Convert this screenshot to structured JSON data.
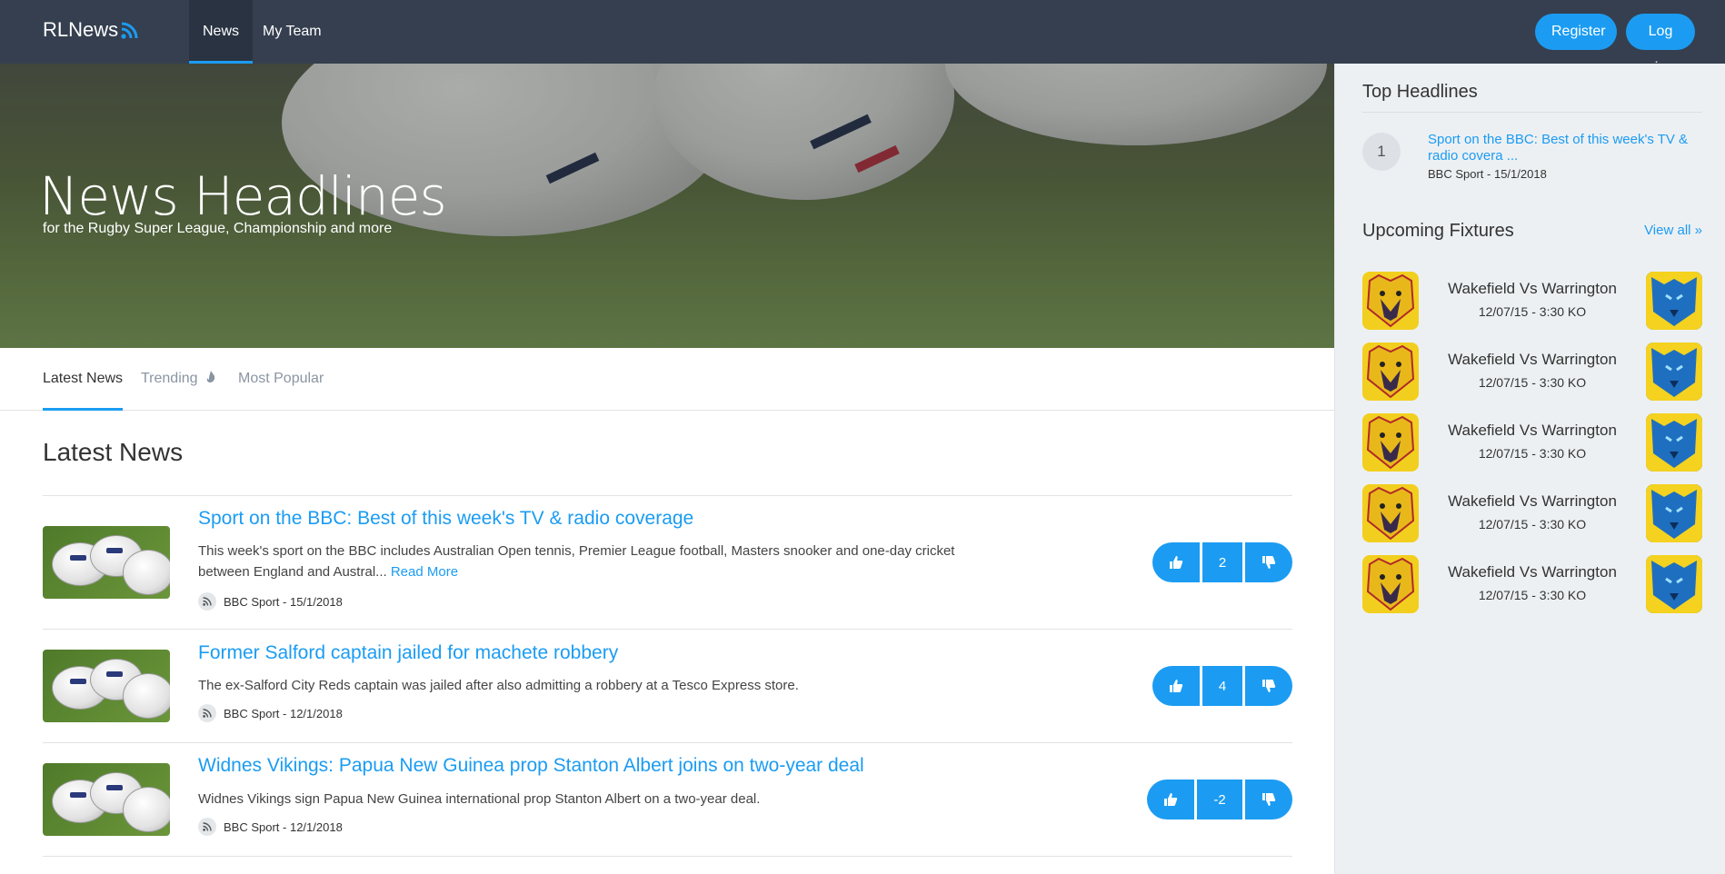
{
  "brand": {
    "name": "RLNews"
  },
  "nav": {
    "tabs": [
      {
        "label": "News"
      },
      {
        "label": "My Team"
      }
    ]
  },
  "auth": {
    "register_label": "Register",
    "login_label": "Log in"
  },
  "hero": {
    "title": "News Headlines",
    "subtitle": "for the Rugby Super League, Championship and more"
  },
  "tabs": [
    {
      "label": "Latest News"
    },
    {
      "label": "Trending"
    },
    {
      "label": "Most Popular"
    }
  ],
  "main": {
    "section_title": "Latest News"
  },
  "news": [
    {
      "title": "Sport on the BBC: Best of this week's TV & radio coverage",
      "description": "This week's sport on the BBC includes Australian Open tennis, Premier League football, Masters snooker and one-day cricket between England and Austral...",
      "read_more": "Read More",
      "meta": "BBC Sport - 15/1/2018",
      "votes": "2"
    },
    {
      "title": "Former Salford captain jailed for machete robbery",
      "description": "The ex-Salford City Reds captain was jailed after also admitting a robbery at a Tesco Express store.",
      "meta": "BBC Sport - 12/1/2018",
      "votes": "4"
    },
    {
      "title": "Widnes Vikings: Papua New Guinea prop Stanton Albert joins on two-year deal",
      "description": "Widnes Vikings sign Papua New Guinea international prop Stanton Albert on a two-year deal.",
      "meta": "BBC Sport - 12/1/2018",
      "votes": "-2"
    }
  ],
  "sidebar": {
    "top_headlines_title": "Top Headlines",
    "top_headline": {
      "rank": "1",
      "title": "Sport on the BBC: Best of this week's TV & radio covera ...",
      "meta": "BBC Sport - 15/1/2018"
    },
    "fixtures_title": "Upcoming Fixtures",
    "view_all": "View all »",
    "fixtures": [
      {
        "name": "Wakefield Vs Warrington",
        "time": "12/07/15 - 3:30 KO"
      },
      {
        "name": "Wakefield Vs Warrington",
        "time": "12/07/15 - 3:30 KO"
      },
      {
        "name": "Wakefield Vs Warrington",
        "time": "12/07/15 - 3:30 KO"
      },
      {
        "name": "Wakefield Vs Warrington",
        "time": "12/07/15 - 3:30 KO"
      },
      {
        "name": "Wakefield Vs Warrington",
        "time": "12/07/15 - 3:30 KO"
      }
    ]
  },
  "icons": {
    "brand": "rss-icon",
    "trending": "fire-icon",
    "upvote": "thumbs-up-icon",
    "downvote": "thumbs-down-icon",
    "source": "rss-icon"
  },
  "colors": {
    "accent": "#1b9cf2",
    "nav_bg": "#353f4f",
    "sidebar_bg": "#edf0f3"
  }
}
